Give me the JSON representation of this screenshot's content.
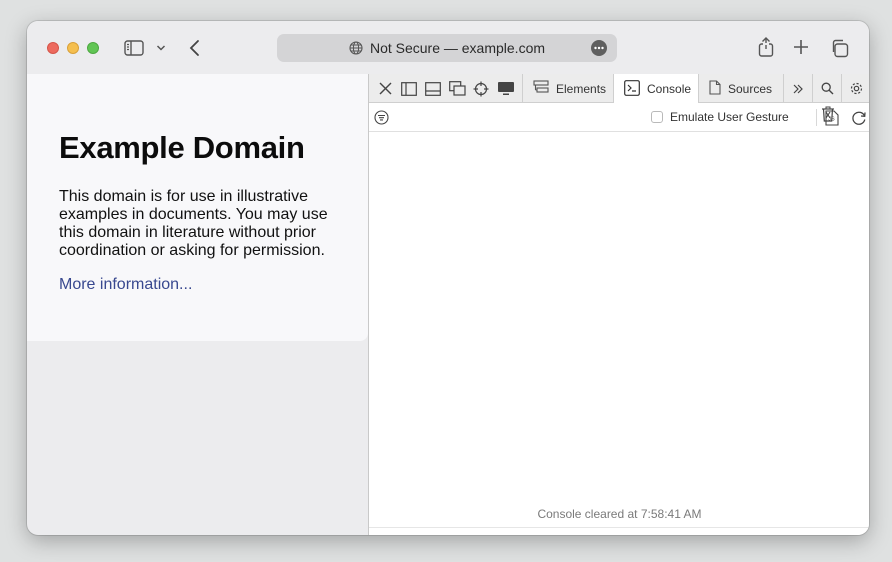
{
  "browser": {
    "address_text": "Not Secure — example.com"
  },
  "page": {
    "heading": "Example Domain",
    "paragraph": "This domain is for use in illustrative examples in documents. You may use this domain in literature without prior coordination or asking for permission.",
    "link": "More information..."
  },
  "devtools": {
    "tabs": [
      {
        "label": "Elements",
        "icon": "elements-icon"
      },
      {
        "label": "Console",
        "icon": "console-icon",
        "active": true
      },
      {
        "label": "Sources",
        "icon": "sources-icon"
      }
    ],
    "emulate_label": "Emulate User Gesture",
    "console_message": "Console cleared at 7:58:41 AM"
  },
  "colors": {
    "link": "#38488f",
    "prompt": "#1f6fe0"
  }
}
